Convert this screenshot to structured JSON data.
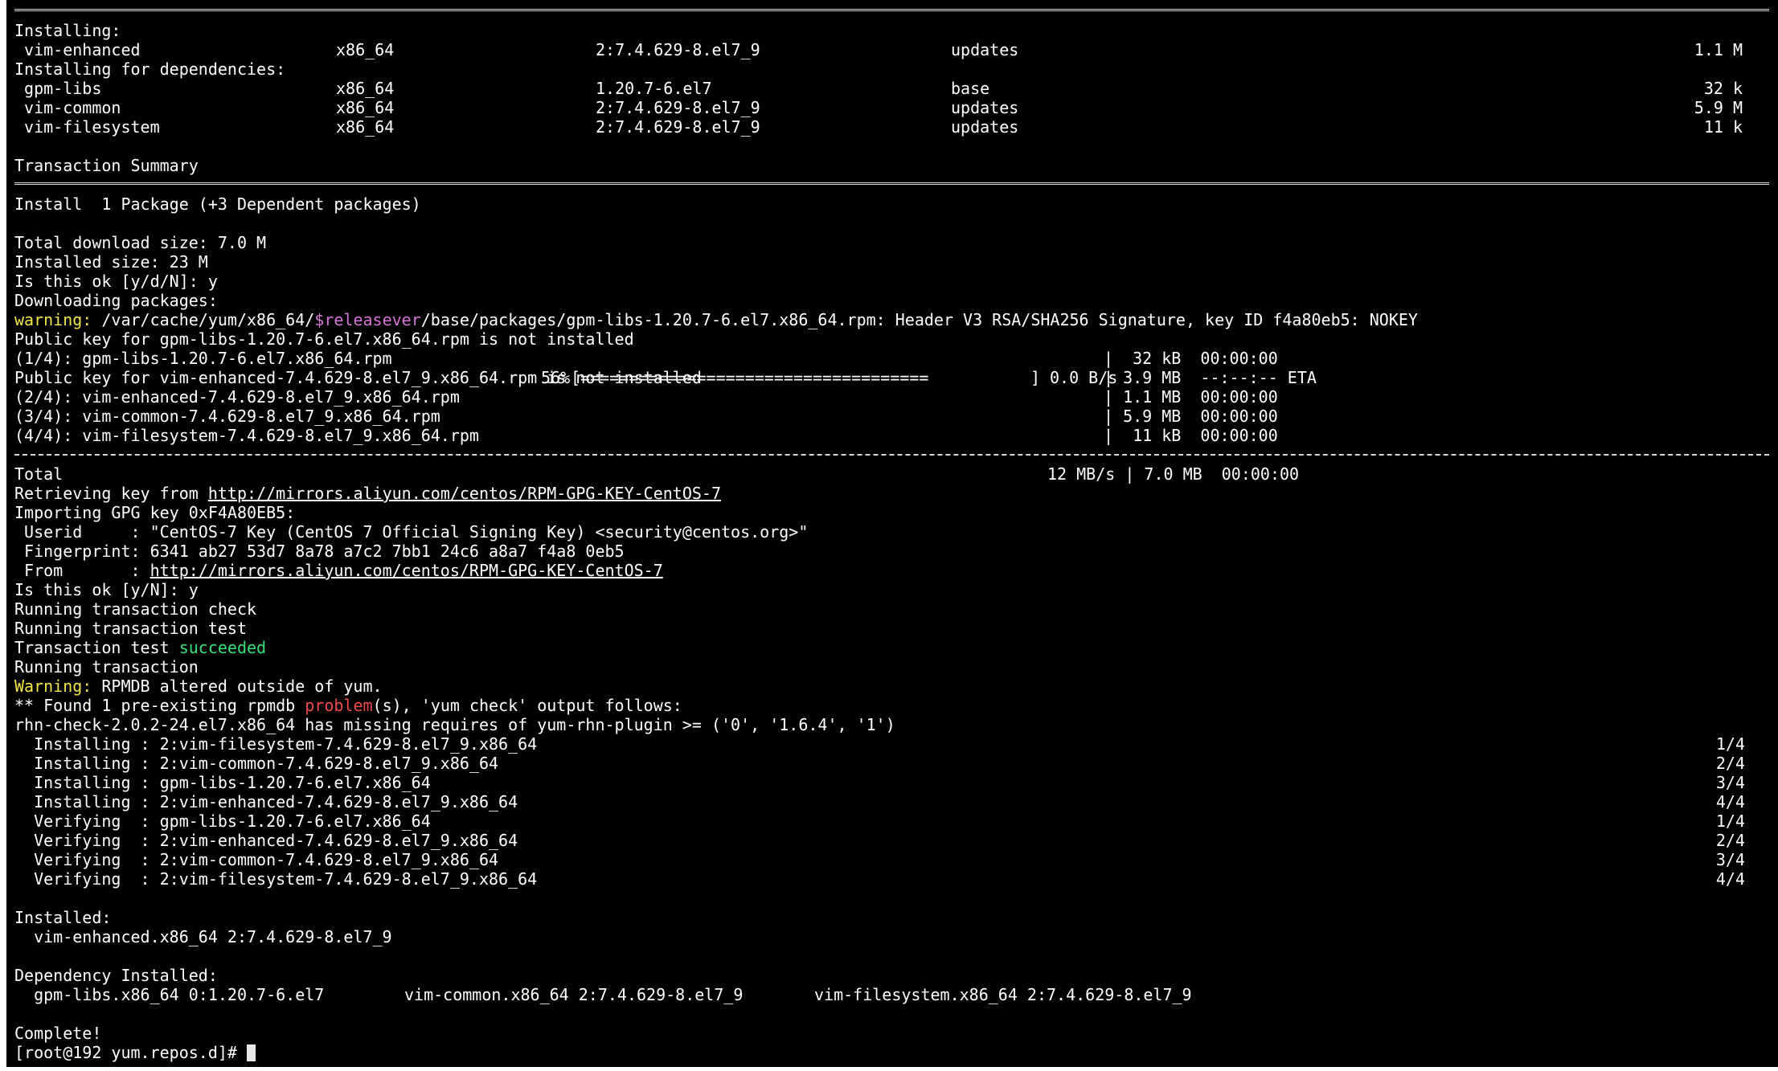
{
  "separator_eq": "=",
  "separator_dash": "-",
  "installing_header": "Installing:",
  "installing": [
    {
      "name": " vim-enhanced",
      "arch": "x86_64",
      "version": "2:7.4.629-8.el7_9",
      "repo": "updates",
      "size": "1.1 M"
    }
  ],
  "deps_header": "Installing for dependencies:",
  "deps": [
    {
      "name": " gpm-libs",
      "arch": "x86_64",
      "version": "1.20.7-6.el7",
      "repo": "base",
      "size": "32 k"
    },
    {
      "name": " vim-common",
      "arch": "x86_64",
      "version": "2:7.4.629-8.el7_9",
      "repo": "updates",
      "size": "5.9 M"
    },
    {
      "name": " vim-filesystem",
      "arch": "x86_64",
      "version": "2:7.4.629-8.el7_9",
      "repo": "updates",
      "size": "11 k"
    }
  ],
  "transaction_summary": "Transaction Summary",
  "install_count": "Install  1 Package (+3 Dependent packages)",
  "total_download": "Total download size: 7.0 M",
  "installed_size": "Installed size: 23 M",
  "prompt_ok_1": "Is this ok [y/d/N]: y",
  "downloading": "Downloading packages:",
  "warning_label": "warning:",
  "warning_path_a": " /var/cache/yum/x86_64/",
  "warning_var": "$releasever",
  "warning_path_b": "/base/packages/gpm-libs-1.20.7-6.el7.x86_64.rpm: Header V3 RSA/SHA256 Signature, key ID f4a80eb5: NOKEY",
  "pubkey_gpm": "Public key for gpm-libs-1.20.7-6.el7.x86_64.rpm is not installed",
  "downloads": [
    {
      "label": "(1/4): gpm-libs-1.20.7-6.el7.x86_64.rpm",
      "stats": "|  32 kB  00:00:00"
    }
  ],
  "pubkey_vim": "Public key for vim-enhanced-7.4.629-8.el7_9.x86_64.rpm is not installed",
  "progress": {
    "percent": "56%",
    "bar_open": "[",
    "bar_fill": "====================================",
    "bar_close": "]",
    "rate": "0.0 B/s",
    "stats": "| 3.9 MB  --:--:-- ETA"
  },
  "downloads_rest": [
    {
      "label": "(2/4): vim-enhanced-7.4.629-8.el7_9.x86_64.rpm",
      "stats": "| 1.1 MB  00:00:00"
    },
    {
      "label": "(3/4): vim-common-7.4.629-8.el7_9.x86_64.rpm",
      "stats": "| 5.9 MB  00:00:00"
    },
    {
      "label": "(4/4): vim-filesystem-7.4.629-8.el7_9.x86_64.rpm",
      "stats": "|  11 kB  00:00:00"
    }
  ],
  "total_label": "Total",
  "total_stats": "12 MB/s | 7.0 MB  00:00:00",
  "retrieving_prefix": "Retrieving key from ",
  "gpg_url": "http://mirrors.aliyun.com/centos/RPM-GPG-KEY-CentOS-7",
  "importing": "Importing GPG key 0xF4A80EB5:",
  "userid": " Userid     : \"CentOS-7 Key (CentOS 7 Official Signing Key) <security@centos.org>\"",
  "fingerprint": " Fingerprint: 6341 ab27 53d7 8a78 a7c2 7bb1 24c6 a8a7 f4a8 0eb5",
  "from_prefix": " From       : ",
  "prompt_ok_2": "Is this ok [y/N]: y",
  "run_check": "Running transaction check",
  "run_test": "Running transaction test",
  "test_prefix": "Transaction test ",
  "test_result": "succeeded",
  "run_transaction": "Running transaction",
  "rpmdb_warning_label": "Warning:",
  "rpmdb_warning_text": " RPMDB altered outside of yum.",
  "found_prefix": "** Found 1 pre-existing rpmdb ",
  "found_problem": "problem",
  "found_suffix": "(s), 'yum check' output follows:",
  "rhn_check": "rhn-check-2.0.2-24.el7.x86_64 has missing requires of yum-rhn-plugin >= ('0', '1.6.4', '1')",
  "steps": [
    {
      "text": "  Installing : 2:vim-filesystem-7.4.629-8.el7_9.x86_64",
      "count": "1/4"
    },
    {
      "text": "  Installing : 2:vim-common-7.4.629-8.el7_9.x86_64",
      "count": "2/4"
    },
    {
      "text": "  Installing : gpm-libs-1.20.7-6.el7.x86_64",
      "count": "3/4"
    },
    {
      "text": "  Installing : 2:vim-enhanced-7.4.629-8.el7_9.x86_64",
      "count": "4/4"
    },
    {
      "text": "  Verifying  : gpm-libs-1.20.7-6.el7.x86_64",
      "count": "1/4"
    },
    {
      "text": "  Verifying  : 2:vim-enhanced-7.4.629-8.el7_9.x86_64",
      "count": "2/4"
    },
    {
      "text": "  Verifying  : 2:vim-common-7.4.629-8.el7_9.x86_64",
      "count": "3/4"
    },
    {
      "text": "  Verifying  : 2:vim-filesystem-7.4.629-8.el7_9.x86_64",
      "count": "4/4"
    }
  ],
  "installed_header": "Installed:",
  "installed_item": "  vim-enhanced.x86_64 2:7.4.629-8.el7_9",
  "dep_installed_header": "Dependency Installed:",
  "dep_installed": [
    "  gpm-libs.x86_64 0:1.20.7-6.el7",
    "vim-common.x86_64 2:7.4.629-8.el7_9",
    "vim-filesystem.x86_64 2:7.4.629-8.el7_9"
  ],
  "complete": "Complete!",
  "shell_prompt": "[root@192 yum.repos.d]# ",
  "colors": {
    "background": "#000000",
    "foreground": "#ffffff",
    "warning": "#f0e64a",
    "variable": "#d575d8",
    "success": "#35e07a",
    "error": "#f04848"
  }
}
